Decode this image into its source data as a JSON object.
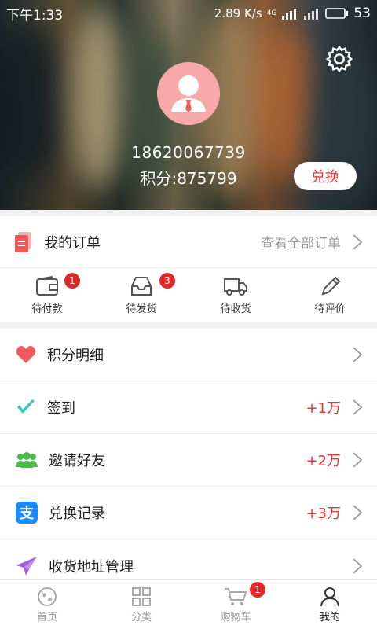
{
  "status_bar": {
    "time": "下午1:33",
    "speed": "2.89 K/s",
    "network": "4G",
    "battery": "53"
  },
  "profile": {
    "phone": "18620067739",
    "points_label": "积分:875799",
    "exchange_button": "兑换"
  },
  "orders": {
    "title": "我的订单",
    "view_all": "查看全部订单",
    "statuses": [
      {
        "label": "待付款",
        "badge": "1",
        "icon": "wallet-icon"
      },
      {
        "label": "待发货",
        "badge": "3",
        "icon": "inbox-icon"
      },
      {
        "label": "待收货",
        "badge": "",
        "icon": "truck-icon"
      },
      {
        "label": "待评价",
        "badge": "",
        "icon": "pencil-icon"
      }
    ]
  },
  "menu": [
    {
      "label": "积分明细",
      "value": "",
      "icon": "heart-icon",
      "color": "#f05a5a"
    },
    {
      "label": "签到",
      "value": "+1万",
      "icon": "check-icon",
      "color": "#3cc8c0"
    },
    {
      "label": "邀请好友",
      "value": "+2万",
      "icon": "friends-icon",
      "color": "#4cbb4c"
    },
    {
      "label": "兑换记录",
      "value": "+3万",
      "icon": "alipay-icon",
      "color": "#1a8cff"
    },
    {
      "label": "收货地址管理",
      "value": "",
      "icon": "paper-plane-icon",
      "color": "#a35ee0"
    }
  ],
  "tabbar": [
    {
      "label": "首页",
      "icon": "globe-icon",
      "active": false,
      "badge": ""
    },
    {
      "label": "分类",
      "icon": "grid-icon",
      "active": false,
      "badge": ""
    },
    {
      "label": "购物车",
      "icon": "cart-icon",
      "active": false,
      "badge": "1"
    },
    {
      "label": "我的",
      "icon": "user-icon",
      "active": true,
      "badge": ""
    }
  ],
  "colors": {
    "accent": "#e53935",
    "badge": "#e02828"
  }
}
